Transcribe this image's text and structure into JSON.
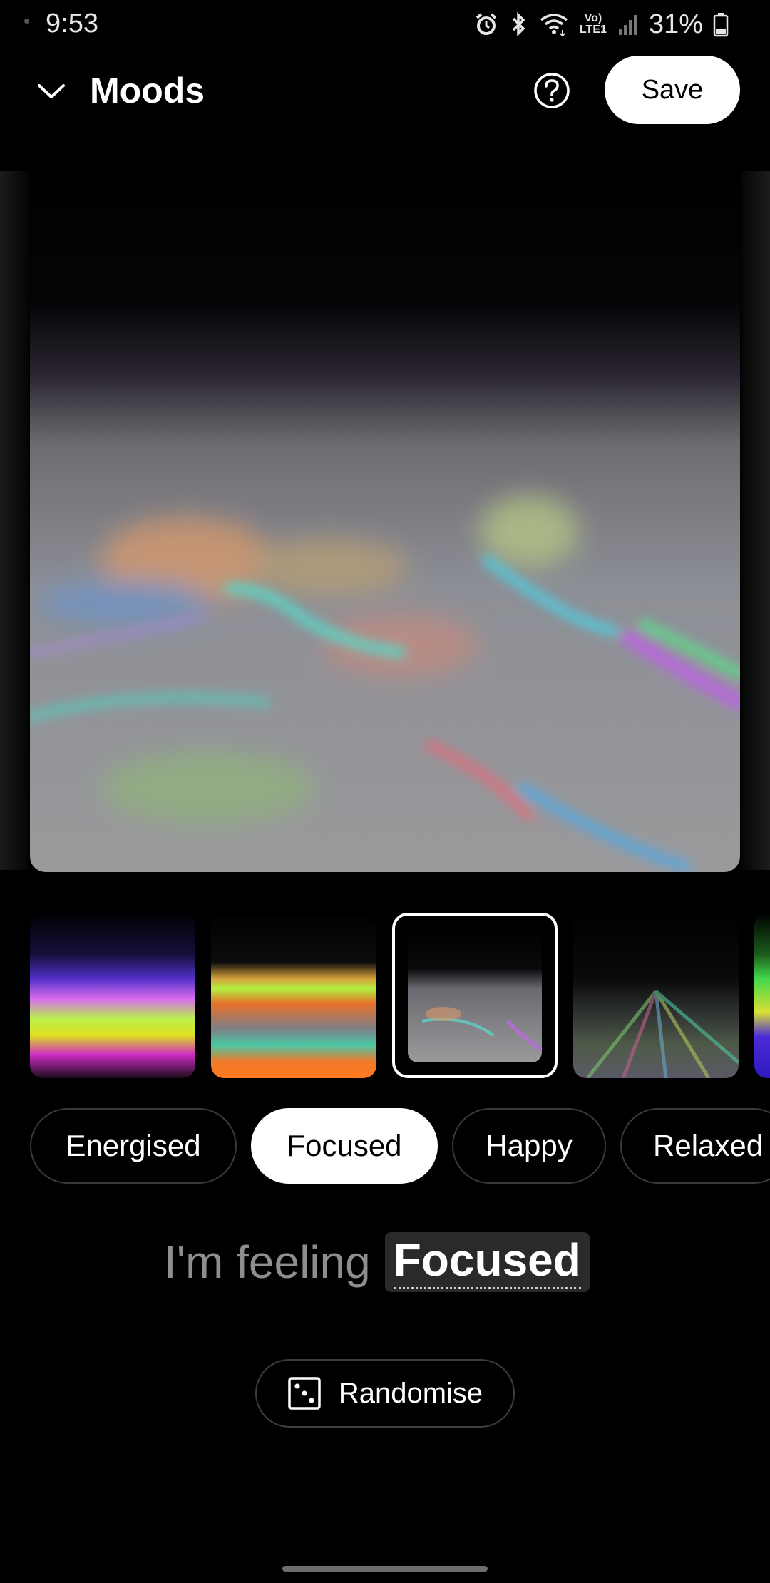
{
  "status_bar": {
    "time": "9:53",
    "network_label": "Vo) LTE1",
    "battery_percent": "31%",
    "icons": [
      "alarm-icon",
      "bluetooth-icon",
      "wifi-icon",
      "volte-icon",
      "signal-icon",
      "battery-icon"
    ]
  },
  "header": {
    "title": "Moods",
    "back_icon": "chevron-down-icon",
    "help_icon": "help-circle-icon",
    "save_label": "Save"
  },
  "thumbnails": {
    "count_visible": 5,
    "selected_index": 2
  },
  "moods": {
    "items": [
      "Energised",
      "Focused",
      "Happy",
      "Relaxed"
    ],
    "selected": "Focused"
  },
  "feeling": {
    "prefix": "I'm feeling",
    "mood": "Focused"
  },
  "randomise": {
    "label": "Randomise",
    "icon": "dice-icon"
  },
  "colors": {
    "background": "#000000",
    "selected_chip_bg": "#ffffff",
    "chip_border": "#3a3a3a",
    "muted_text": "#8e8e8e"
  }
}
